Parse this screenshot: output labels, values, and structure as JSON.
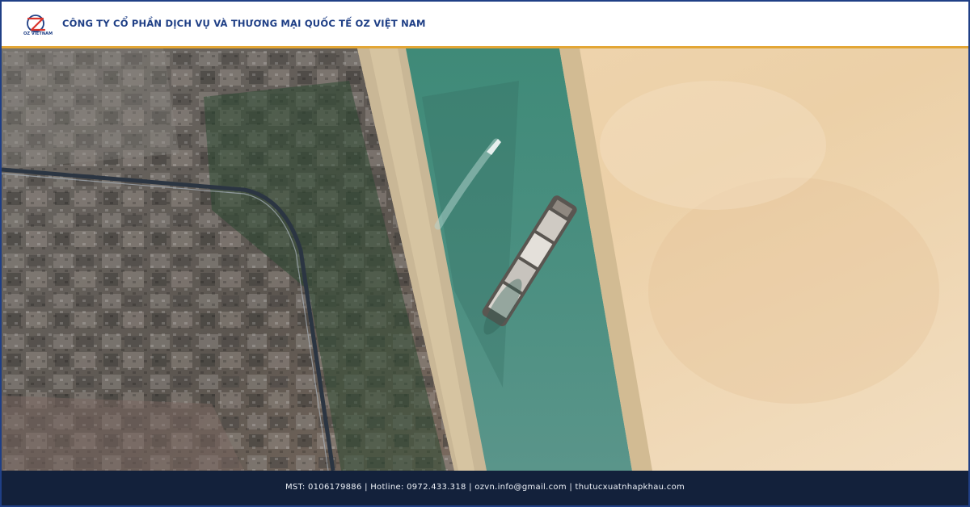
{
  "header": {
    "logo_text": "OZ VIETNAM",
    "company_name": "CÔNG TY CỔ PHẦN DỊCH VỤ VÀ THƯƠNG MẠI QUỐC TẾ OZ VIỆT NAM"
  },
  "image": {
    "subject": "satellite-view-ship-in-canal"
  },
  "footer": {
    "contact_line": "MST: 0106179886  |  Hotline: 0972.433.318  |  ozvn.info@gmail.com  |  thutucxuatnhapkhau.com"
  },
  "colors": {
    "brand_blue": "#1f3f86",
    "accent_orange": "#e3a635",
    "footer_bg": "#13213b"
  }
}
